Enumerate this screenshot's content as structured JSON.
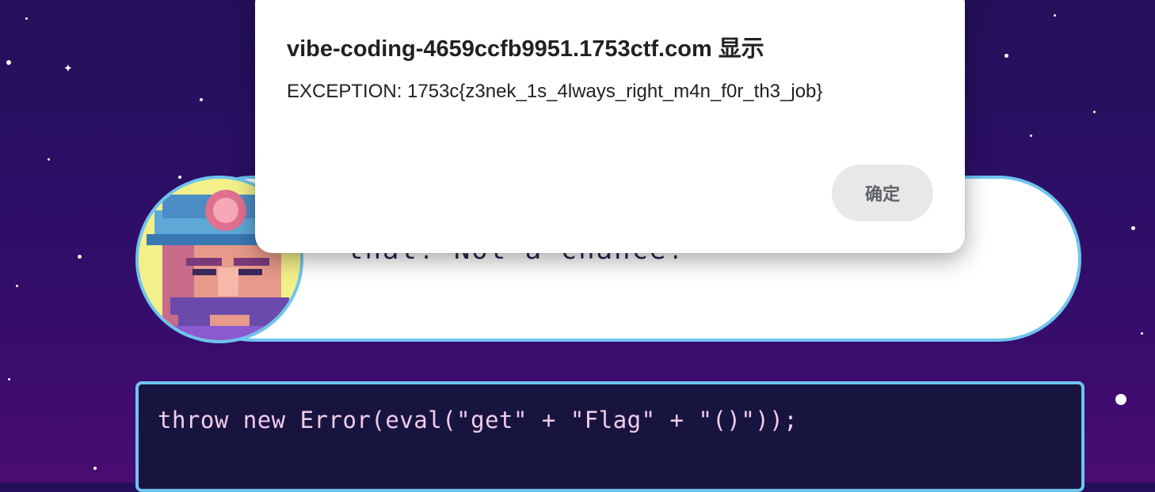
{
  "dialog": {
    "title": "vibe-coding-4659ccfb9951.1753ctf.com 显示",
    "message": "EXCEPTION: 1753c{z3nek_1s_4lways_right_m4n_f0r_th3_job}",
    "ok_label": "确定"
  },
  "bubble": {
    "text_partial": "that! Not a chance!"
  },
  "code": {
    "line": "throw new Error(eval(\"get\" + \"Flag\" + \"()\"));"
  },
  "colors": {
    "background_top": "#24105a",
    "background_bottom": "#4a0c72",
    "accent_border": "#6ec4ee",
    "code_bg": "#181440",
    "code_text": "#f2cce8"
  },
  "icons": {
    "avatar": "miner-avatar-icon"
  }
}
